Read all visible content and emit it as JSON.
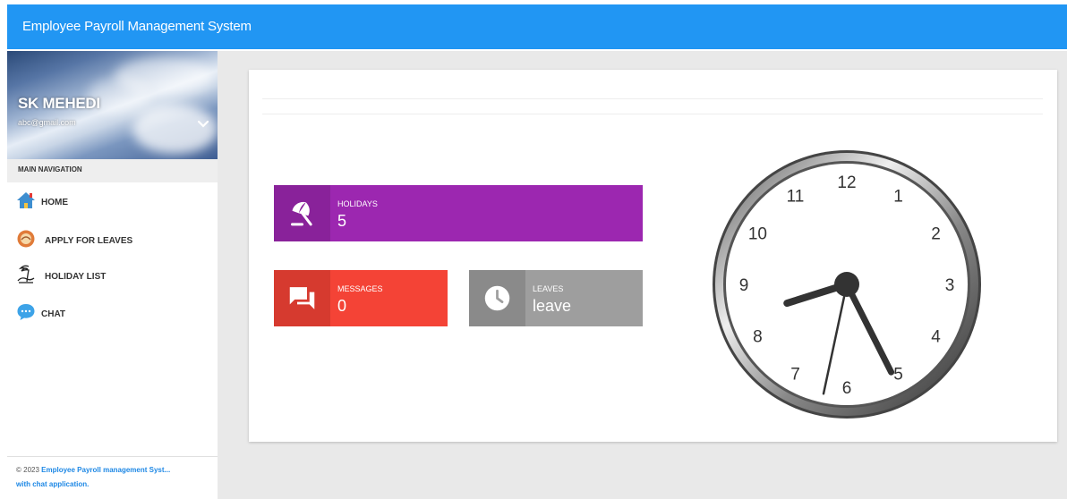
{
  "app": {
    "title": "Employee Payroll Management System"
  },
  "user": {
    "name": "SK MEHEDI",
    "email": "abc@gmail.com"
  },
  "sidebar": {
    "nav_header": "MAIN NAVIGATION",
    "items": [
      {
        "label": "HOME",
        "icon": "home-icon"
      },
      {
        "label": "APPLY FOR LEAVES",
        "icon": "leaves-icon"
      },
      {
        "label": "HOLIDAY LIST",
        "icon": "holiday-icon"
      },
      {
        "label": "CHAT",
        "icon": "chat-icon"
      }
    ]
  },
  "footer": {
    "copyright": "© 2023",
    "link_line1": "Employee Payroll management Syst...",
    "link_line2": "with chat application."
  },
  "widgets": {
    "holidays": {
      "title": "HOLIDAYS",
      "value": "5",
      "color": "#9c27b0",
      "icon": "umbrella-icon"
    },
    "messages": {
      "title": "MESSAGES",
      "value": "0",
      "color": "#f44336",
      "icon": "forum-icon"
    },
    "leaves": {
      "title": "LEAVES",
      "value": "leave",
      "color": "#9e9e9e",
      "icon": "clock-icon"
    }
  },
  "clock": {
    "numerals": [
      "12",
      "1",
      "2",
      "3",
      "4",
      "5",
      "6",
      "7",
      "8",
      "9",
      "10",
      "11"
    ],
    "hour": 8,
    "minute": 25,
    "second": 32
  },
  "colors": {
    "topbar": "#2196f3",
    "content_bg": "#e9e9e9",
    "link": "#1e88e5"
  }
}
